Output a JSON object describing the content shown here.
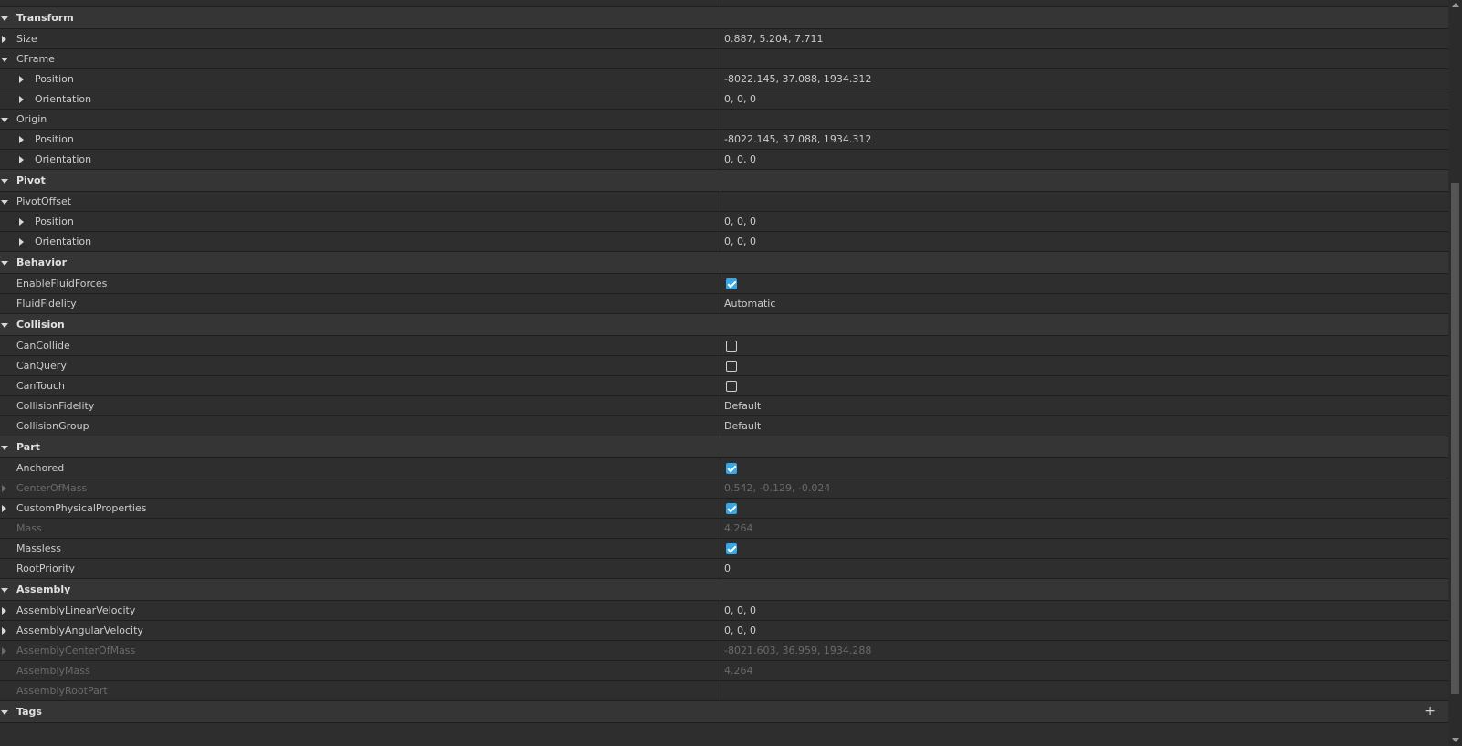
{
  "sections": [
    {
      "label": "Transform",
      "rows": [
        {
          "label": "Size",
          "value": "0.887, 5.204, 7.711",
          "arrow": "right",
          "level": 0
        },
        {
          "label": "CFrame",
          "value": "",
          "arrow": "down",
          "level": 0
        },
        {
          "label": "Position",
          "value": "-8022.145, 37.088, 1934.312",
          "arrow": "right",
          "level": 1
        },
        {
          "label": "Orientation",
          "value": "0, 0, 0",
          "arrow": "right",
          "level": 1
        },
        {
          "label": "Origin",
          "value": "",
          "arrow": "down",
          "level": 0
        },
        {
          "label": "Position",
          "value": "-8022.145, 37.088, 1934.312",
          "arrow": "right",
          "level": 1
        },
        {
          "label": "Orientation",
          "value": "0, 0, 0",
          "arrow": "right",
          "level": 1
        }
      ]
    },
    {
      "label": "Pivot",
      "rows": [
        {
          "label": "PivotOffset",
          "value": "",
          "arrow": "down",
          "level": 0
        },
        {
          "label": "Position",
          "value": "0, 0, 0",
          "arrow": "right",
          "level": 1
        },
        {
          "label": "Orientation",
          "value": "0, 0, 0",
          "arrow": "right",
          "level": 1
        }
      ]
    },
    {
      "label": "Behavior",
      "rows": [
        {
          "label": "EnableFluidForces",
          "checkbox": true,
          "checked": true
        },
        {
          "label": "FluidFidelity",
          "value": "Automatic"
        }
      ]
    },
    {
      "label": "Collision",
      "rows": [
        {
          "label": "CanCollide",
          "checkbox": true,
          "checked": false
        },
        {
          "label": "CanQuery",
          "checkbox": true,
          "checked": false
        },
        {
          "label": "CanTouch",
          "checkbox": true,
          "checked": false
        },
        {
          "label": "CollisionFidelity",
          "value": "Default"
        },
        {
          "label": "CollisionGroup",
          "value": "Default"
        }
      ]
    },
    {
      "label": "Part",
      "rows": [
        {
          "label": "Anchored",
          "checkbox": true,
          "checked": true
        },
        {
          "label": "CenterOfMass",
          "value": "0.542, -0.129, -0.024",
          "arrow": "right",
          "disabled": true
        },
        {
          "label": "CustomPhysicalProperties",
          "checkbox": true,
          "checked": true,
          "arrow": "right"
        },
        {
          "label": "Mass",
          "value": "4.264",
          "disabled": true
        },
        {
          "label": "Massless",
          "checkbox": true,
          "checked": true
        },
        {
          "label": "RootPriority",
          "value": "0"
        }
      ]
    },
    {
      "label": "Assembly",
      "rows": [
        {
          "label": "AssemblyLinearVelocity",
          "value": "0, 0, 0",
          "arrow": "right"
        },
        {
          "label": "AssemblyAngularVelocity",
          "value": "0, 0, 0",
          "arrow": "right"
        },
        {
          "label": "AssemblyCenterOfMass",
          "value": "-8021.603, 36.959, 1934.288",
          "arrow": "right",
          "disabled": true
        },
        {
          "label": "AssemblyMass",
          "value": "4.264",
          "disabled": true
        },
        {
          "label": "AssemblyRootPart",
          "value": "",
          "disabled": true
        }
      ]
    },
    {
      "label": "Tags",
      "rows": [],
      "add_button": "+"
    }
  ],
  "colors": {
    "accent": "#35a8e6",
    "background": "#2e2e2e",
    "section": "#353535",
    "disabled_text": "#6a6a6a"
  },
  "icons": {
    "expanded": "triangle-down-icon",
    "collapsed": "triangle-right-icon",
    "add": "plus-icon",
    "check": "checkmark-icon"
  }
}
